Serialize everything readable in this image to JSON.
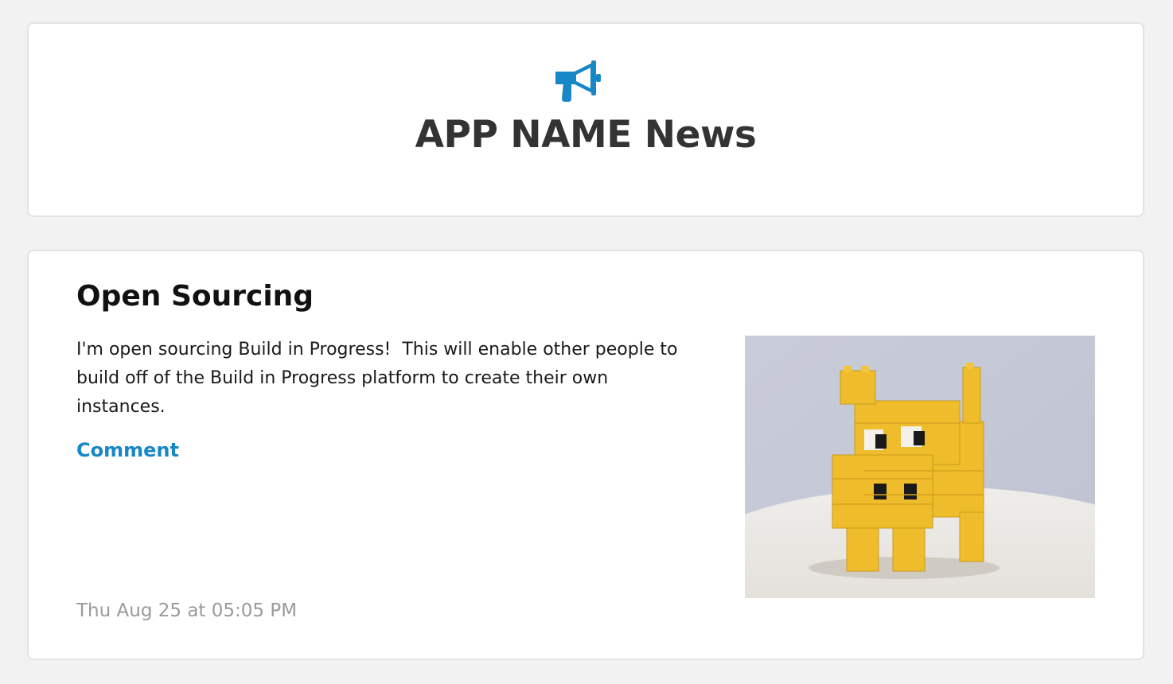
{
  "header": {
    "icon": "megaphone-icon",
    "title": "APP NAME News"
  },
  "post": {
    "title": "Open Sourcing",
    "body": "I'm open sourcing Build in Progress!  This will enable other people to build off of the Build in Progress platform to create their own instances.",
    "comment_label": "Comment",
    "date": "Thu Aug 25 at 05:05 PM",
    "image": "yellow-lego-cow-photo"
  },
  "colors": {
    "background": "#f2f2f2",
    "card": "#ffffff",
    "accent": "#1787c7",
    "title_text": "#333333",
    "date_text": "#9a9a9a"
  }
}
